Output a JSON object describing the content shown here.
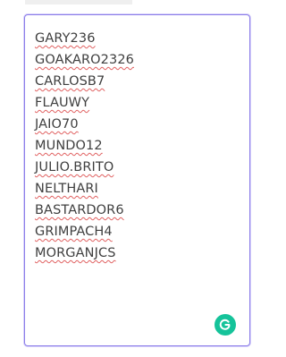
{
  "textarea": {
    "lines": [
      "GARY236",
      "GOAKARO2326",
      "CARLOSB7",
      "FLAUWY",
      "JAIO70",
      "MUNDO12",
      "JULIO.BRITO",
      "NELTHARI",
      "BASTARDOR6",
      "GRIMPACH4",
      "MORGANJCS"
    ],
    "accent_color": "#8c7ee8",
    "spellcheck_underline_color": "#e06060"
  },
  "grammarly_badge": {
    "icon": "grammarly-g-icon",
    "color": "#15c39a"
  }
}
